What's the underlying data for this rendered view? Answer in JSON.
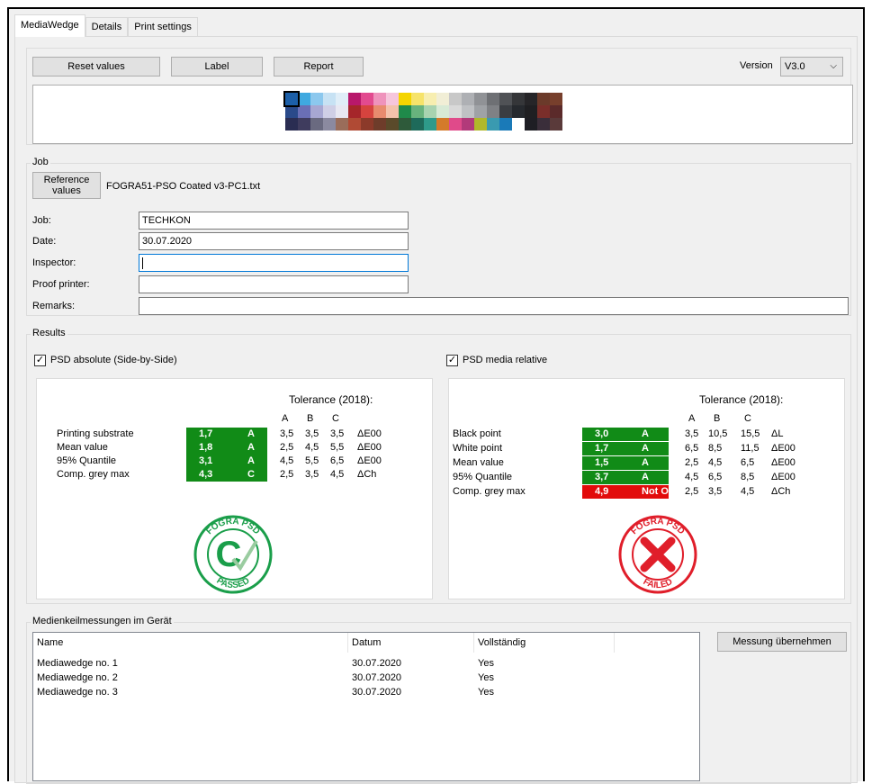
{
  "tabs": [
    "MediaWedge",
    "Details",
    "Print settings"
  ],
  "toolbar": {
    "reset_label": "Reset values",
    "label_label": "Label",
    "report_label": "Report",
    "version_label": "Version",
    "version_value": "V3.0"
  },
  "wedge": {
    "row1": [
      "#1c5fa8",
      "#3fa9e0",
      "#8cc8ee",
      "#c7e2f4",
      "#e0eef8",
      "#b8186b",
      "#e24a8f",
      "#ef93bc",
      "#f6c6dc",
      "#f4d500",
      "#f6e36a",
      "#f7eeb0",
      "#f1eed6",
      "#c8c8c8",
      "#aeb0b4",
      "#909296",
      "#6e7074",
      "#505256",
      "#353639",
      "#262528",
      "#6b3a2a",
      "#773f2c"
    ],
    "row2": [
      "#2a4a8a",
      "#6a6fb5",
      "#a7a7d2",
      "#cfcfe6",
      "#e8e8f2",
      "#a5262a",
      "#d6433e",
      "#e88b6e",
      "#f3c2ab",
      "#1f8a4a",
      "#68b37d",
      "#a8d3b0",
      "#d8ead6",
      "#d9d9d9",
      "#bfc1c4",
      "#9fa2a6",
      "#7f8185",
      "#3a3d42",
      "#26292e",
      "#1f1f22",
      "#7a2e2a",
      "#5b2a2a"
    ],
    "row3": [
      "#2a2d52",
      "#3f3c5e",
      "#6a6a80",
      "#8b8aa0",
      "#9a6d5a",
      "#b04a34",
      "#8c3a2a",
      "#6e3c2a",
      "#5a4a2a",
      "#2e5a3a",
      "#1e6a5a",
      "#2e9a8a",
      "#d47a2a",
      "#e04a8a",
      "#b23a7a",
      "#b0b82a",
      "#3a9ab0",
      "#1a7ab8",
      "#ffffff",
      "#1e1e24",
      "#3a2e3a",
      "#5a3a3a"
    ]
  },
  "job": {
    "group_title": "Job",
    "ref_button_line1": "Reference",
    "ref_button_line2": "values",
    "ref_file": "FOGRA51-PSO Coated v3-PC1.txt",
    "fields": [
      {
        "label": "Job:",
        "value": "TECHKON"
      },
      {
        "label": "Date:",
        "value": "30.07.2020"
      },
      {
        "label": "Inspector:",
        "value": ""
      },
      {
        "label": "Proof printer:",
        "value": ""
      },
      {
        "label": "Remarks:",
        "value": ""
      }
    ]
  },
  "results": {
    "group_title": "Results",
    "left": {
      "check_label": "PSD absolute (Side-by-Side)",
      "tolerance_title": "Tolerance (2018):",
      "cols": [
        "A",
        "B",
        "C"
      ],
      "rows": [
        {
          "label": "Printing substrate",
          "value": "1,7",
          "grade": "A",
          "a": "3,5",
          "b": "3,5",
          "c": "3,5",
          "unit": "ΔE00",
          "status": "pass"
        },
        {
          "label": "Mean value",
          "value": "1,8",
          "grade": "A",
          "a": "2,5",
          "b": "4,5",
          "c": "5,5",
          "unit": "ΔE00",
          "status": "pass"
        },
        {
          "label": "95% Quantile",
          "value": "3,1",
          "grade": "A",
          "a": "4,5",
          "b": "5,5",
          "c": "6,5",
          "unit": "ΔE00",
          "status": "pass"
        },
        {
          "label": "Comp. grey max",
          "value": "4,3",
          "grade": "C",
          "a": "2,5",
          "b": "3,5",
          "c": "4,5",
          "unit": "ΔCh",
          "status": "pass"
        }
      ],
      "seal_top": "FOGRA PSD",
      "seal_bottom": "PASSED",
      "seal_color": "#1a9e4a"
    },
    "right": {
      "check_label": "PSD media relative",
      "tolerance_title": "Tolerance (2018):",
      "cols": [
        "A",
        "B",
        "C"
      ],
      "rows": [
        {
          "label": "Black point",
          "value": "3,0",
          "grade": "A",
          "a": "3,5",
          "b": "10,5",
          "c": "15,5",
          "unit": "ΔL",
          "status": "pass"
        },
        {
          "label": "White point",
          "value": "1,7",
          "grade": "A",
          "a": "6,5",
          "b": "8,5",
          "c": "11,5",
          "unit": "ΔE00",
          "status": "pass"
        },
        {
          "label": "Mean value",
          "value": "1,5",
          "grade": "A",
          "a": "2,5",
          "b": "4,5",
          "c": "6,5",
          "unit": "ΔE00",
          "status": "pass"
        },
        {
          "label": "95% Quantile",
          "value": "3,7",
          "grade": "A",
          "a": "4,5",
          "b": "6,5",
          "c": "8,5",
          "unit": "ΔE00",
          "status": "pass"
        },
        {
          "label": "Comp. grey max",
          "value": "4,9",
          "grade": "Not OK",
          "a": "2,5",
          "b": "3,5",
          "c": "4,5",
          "unit": "ΔCh",
          "status": "fail"
        }
      ],
      "seal_top": "FOGRA PSD",
      "seal_bottom": "FAILED",
      "seal_color": "#e01e2a"
    }
  },
  "measurements": {
    "group_title": "Medienkeilmessungen im Gerät",
    "columns": [
      "Name",
      "Datum",
      "Vollständig"
    ],
    "rows": [
      {
        "name": "Mediawedge no. 1",
        "date": "30.07.2020",
        "complete": "Yes"
      },
      {
        "name": "Mediawedge no. 2",
        "date": "30.07.2020",
        "complete": "Yes"
      },
      {
        "name": "Mediawedge no. 3",
        "date": "30.07.2020",
        "complete": "Yes"
      }
    ],
    "take_button": "Messung übernehmen"
  }
}
